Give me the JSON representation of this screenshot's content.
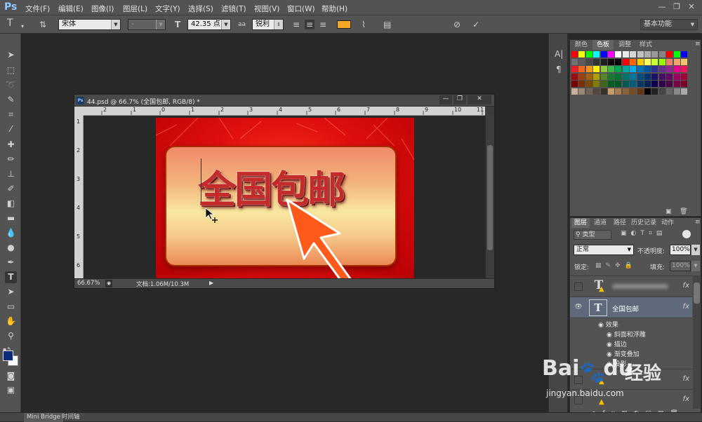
{
  "app": {
    "logo": "Ps",
    "menu": [
      "文件(F)",
      "编辑(E)",
      "图像(I)",
      "图层(L)",
      "文字(Y)",
      "选择(S)",
      "滤镜(T)",
      "视图(V)",
      "窗口(W)",
      "帮助(H)"
    ],
    "window_controls": [
      "—",
      "❐",
      "✕"
    ]
  },
  "options": {
    "font_family": "宋体",
    "font_style": "-",
    "font_size": "42.35 点",
    "aa_icon": "aa",
    "antialias": "锐利",
    "text_color": "#f5a623",
    "workspace": "基本功能",
    "icons": [
      "text-tool-icon",
      "orientation-icon",
      "align-left-icon",
      "align-center-icon",
      "align-right-icon",
      "warp-text-icon",
      "panels-icon",
      "cancel-icon",
      "commit-icon"
    ]
  },
  "document": {
    "title": "44.psd @ 66.7% (全国包邮, RGB/8) *",
    "ruler_h_labels": [
      "2",
      "1",
      "0",
      "1",
      "2",
      "3",
      "4",
      "5",
      "6",
      "7",
      "8",
      "9",
      "10",
      "11"
    ],
    "ruler_v_labels": [
      "1",
      "2",
      "3",
      "4",
      "5",
      "6"
    ],
    "zoom": "66.67%",
    "doc_info": "文档:1.06M/10.3M",
    "headline": "全国包邮"
  },
  "swatches": {
    "tabs": [
      "颜色",
      "色板",
      "调整",
      "样式"
    ],
    "active_tab": "色板",
    "rows": [
      [
        "#ff0000",
        "#ffff00",
        "#00ff00",
        "#00ffff",
        "#0000ff",
        "#ff00ff",
        "#ffffff",
        "#ebebeb",
        "#d6d6d6",
        "#c2c2c2",
        "#adadad",
        "#999999",
        "#858585",
        "#ff0000",
        "#00ff00",
        "#0000ff"
      ],
      [
        "#707070",
        "#5c5c5c",
        "#474747",
        "#333333",
        "#1f1f1f",
        "#0a0a0a",
        "#000000",
        "#ff0000",
        "#ff6600",
        "#ffcc00",
        "#ffff66",
        "#ccff33",
        "#99ff00",
        "#f07f6c",
        "#f3a46b",
        "#f7c56b"
      ],
      [
        "#ed1c24",
        "#f26522",
        "#f7941d",
        "#fff200",
        "#8dc63f",
        "#39b54a",
        "#00a651",
        "#00a99d",
        "#00aeef",
        "#0072bc",
        "#0054a6",
        "#2e3192",
        "#662d91",
        "#92278f",
        "#ec008c",
        "#ed145b"
      ],
      [
        "#9e0b0f",
        "#a0410d",
        "#a36209",
        "#aba000",
        "#598527",
        "#1a7b30",
        "#007236",
        "#00746b",
        "#0076a3",
        "#004b80",
        "#003471",
        "#1b1464",
        "#440e62",
        "#630460",
        "#9e005d",
        "#9e0039"
      ],
      [
        "#790000",
        "#7b2e00",
        "#7d4900",
        "#827b00",
        "#406618",
        "#005e20",
        "#005826",
        "#005952",
        "#005b7f",
        "#003663",
        "#002157",
        "#0d004c",
        "#32004b",
        "#4b0049",
        "#7b0046",
        "#7a0026"
      ],
      [
        "#c7b299",
        "#998675",
        "#736357",
        "#534741",
        "#37302d",
        "#c69c6d",
        "#a67c52",
        "#8c6239",
        "#754c24",
        "#603913",
        "#000000",
        "#222222",
        "#444444",
        "#666666",
        "#888888",
        "#aaaaaa"
      ]
    ]
  },
  "layers": {
    "tabs": [
      "图层",
      "通道",
      "路径",
      "历史记录",
      "动作"
    ],
    "active_tab": "图层",
    "filter_kind": "类型",
    "blend_mode": "正常",
    "opacity_label": "不透明度:",
    "opacity": "100%",
    "lock_label": "锁定:",
    "fill_label": "填充:",
    "fill": "100%",
    "selected_layer": "全国包邮",
    "effects_label": "效果",
    "effects": [
      "斜面和浮雕",
      "描边",
      "渐变叠加",
      "投影"
    ],
    "fx": "fx"
  },
  "bottom_tabs": [
    "Mini Bridge",
    "时间轴"
  ],
  "watermark": {
    "brand": "Bai",
    "brand_suffix": "du",
    "cn": "经验",
    "url": "jingyan.baidu.com"
  }
}
